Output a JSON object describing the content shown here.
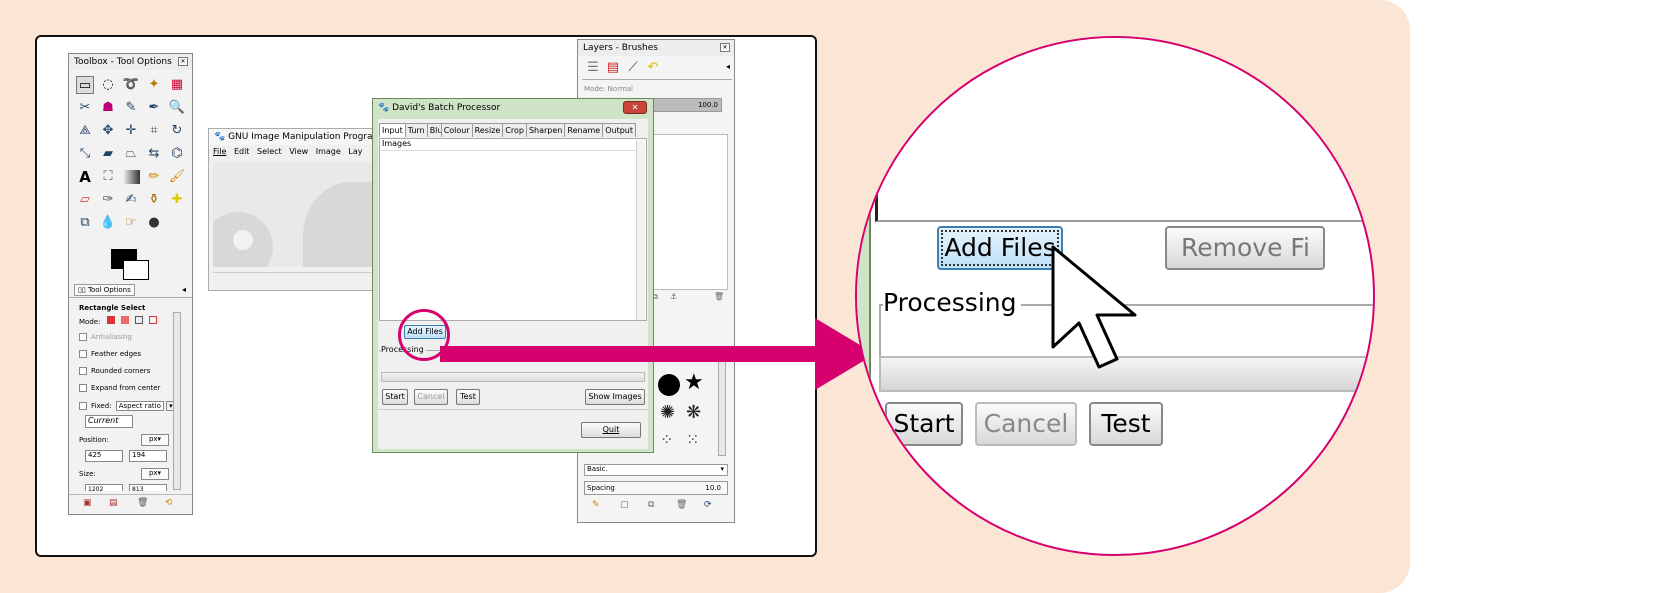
{
  "toolbox": {
    "title": "Toolbox - Tool Options",
    "tab_label": "Tool Options",
    "tool_name": "Rectangle Select",
    "mode_label": "Mode:",
    "options": [
      "Antialiasing",
      "Feather edges",
      "Rounded corners",
      "Expand from center"
    ],
    "fixed_label": "Fixed:",
    "fixed_value": "Aspect ratio",
    "current_value": "Current",
    "position_label": "Position:",
    "position_unit": "px",
    "pos_x": "425",
    "pos_y": "194",
    "size_label": "Size:",
    "size_unit": "px",
    "size_w": "1202",
    "size_h": "813"
  },
  "gimp_main": {
    "title": "GNU Image Manipulation Program",
    "menu": [
      "File",
      "Edit",
      "Select",
      "View",
      "Image",
      "Lay"
    ]
  },
  "layers": {
    "title": "Layers - Brushes",
    "mode_label": "Mode:",
    "mode_value": "Normal",
    "opacity_value": "100.0",
    "brush_category": "Basic.",
    "spacing_label": "Spacing",
    "spacing_value": "10.0"
  },
  "dbp": {
    "title": "David's Batch Processor",
    "tabs": [
      "Input",
      "Turn",
      "Blur",
      "Colour",
      "Resize",
      "Crop",
      "Sharpen",
      "Rename",
      "Output"
    ],
    "images_header": "Images",
    "add_files": "Add Files",
    "processing": "Processing",
    "start": "Start",
    "cancel": "Cancel",
    "test": "Test",
    "show_images": "Show Images",
    "quit": "Quit"
  },
  "zoom": {
    "add_files": "Add Files",
    "remove_files": "Remove Fi",
    "processing": "Processing",
    "start": "Start",
    "cancel": "Cancel",
    "test": "Test"
  },
  "colors": {
    "background": "#fbe6d5",
    "accent": "#d6006e"
  }
}
